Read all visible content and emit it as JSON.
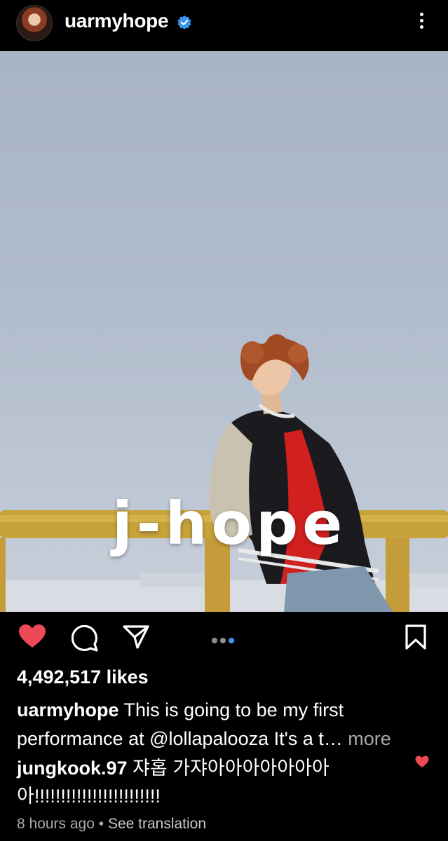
{
  "header": {
    "username": "uarmyhope",
    "verified_icon": "verified-badge-icon",
    "menu_icon": "more-vertical-icon"
  },
  "post": {
    "overlay_text": "j-hope",
    "carousel": {
      "total": 3,
      "active_index": 3
    }
  },
  "actions": {
    "like_icon": "heart-filled-icon",
    "comment_icon": "comment-icon",
    "share_icon": "paper-plane-icon",
    "save_icon": "bookmark-icon"
  },
  "likes": "4,492,517 likes",
  "caption": {
    "username": "uarmyhope",
    "text": " This is going to be my first performance at @lollapalooza It's a t…",
    "more": " more"
  },
  "comment": {
    "username": "jungkook.97",
    "text": " 쟈홉 가쟈아아아아아아아아!!!!!!!!!!!!!!!!!!!!!!!!"
  },
  "meta": {
    "time": "8 hours ago",
    "separator": " • ",
    "see_translation": "See translation"
  },
  "colors": {
    "like_red": "#ed4956",
    "verified_blue": "#3797f0",
    "secondary_text": "#a8a8a8"
  }
}
